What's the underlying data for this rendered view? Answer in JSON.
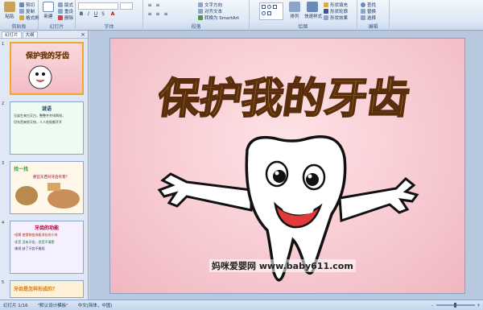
{
  "ribbon": {
    "groups": [
      {
        "label": "剪贴板"
      },
      {
        "label": "幻灯片"
      },
      {
        "label": "字体"
      },
      {
        "label": "段落"
      },
      {
        "label": "绘图"
      },
      {
        "label": "编辑"
      }
    ],
    "clipboard": {
      "paste": "粘贴",
      "cut": "剪切",
      "copy": "复制",
      "format_painter": "格式刷"
    },
    "slides": {
      "new_slide": "新建\n幻灯片",
      "layout": "版式",
      "reset": "重设",
      "delete": "删除"
    },
    "paragraph": {
      "text_direction": "文字方向",
      "align_text": "对齐文本",
      "smartart": "转换为 SmartArt"
    },
    "drawing": {
      "arrange": "排列",
      "quick_styles": "快速样式",
      "fill": "形状填充",
      "outline": "形状轮廓",
      "effects": "形状效果"
    },
    "editing": {
      "find": "查找",
      "replace": "替换",
      "select": "选择"
    }
  },
  "panel": {
    "tabs": [
      "幻灯片",
      "大纲"
    ],
    "close": "×",
    "slides": [
      {
        "num": "1",
        "title": "保护我的牙齿"
      },
      {
        "num": "2",
        "title": "谜语",
        "lines": [
          "兄弟生来白又白，整整齐齐排两排，",
          "切东西来很又快，人人吃饭都开开"
        ]
      },
      {
        "num": "3",
        "title": "找一找",
        "subtitle": "那些东西对牙齿有害？"
      },
      {
        "num": "4",
        "title": "牙齿的功能",
        "lines": [
          "·咀嚼  使食物变成能消化的小块",
          "·发音  没有牙齿，发音不清楚",
          "·美观  缺了牙齿不美观"
        ]
      },
      {
        "num": "5",
        "title": "牙齿是怎样形成的？"
      }
    ]
  },
  "slide": {
    "title": "保护我的牙齿"
  },
  "watermark": "妈咪爱婴网 www.baby611.com",
  "status": {
    "slide_counter": "幻灯片 1/16",
    "theme": "\"默认设计模板\"",
    "language": "中文(简体，中国)"
  },
  "colors": {
    "title_gold": "#e8b81d",
    "slide_bg": "#f9cfd6",
    "ribbon_bg": "#dde8f5"
  }
}
